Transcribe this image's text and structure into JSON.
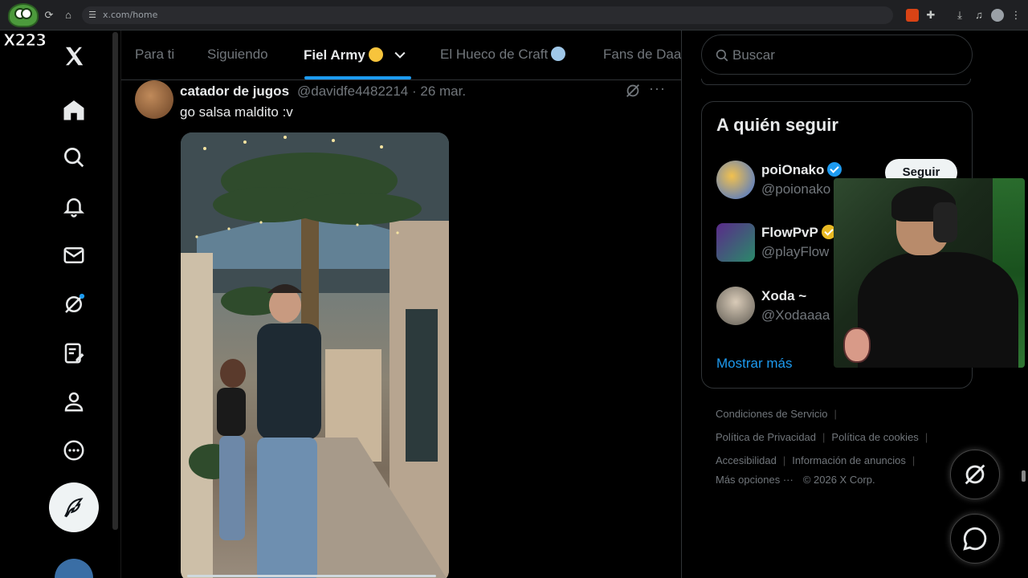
{
  "browser": {
    "url": "x.com/home"
  },
  "overlay": {
    "streamer_tag": "X223"
  },
  "tabs": [
    {
      "label": "Para ti",
      "active": false
    },
    {
      "label": "Siguiendo",
      "active": false
    },
    {
      "label": "Fiel Army",
      "active": true
    },
    {
      "label": "El Hueco de Craft",
      "active": false
    },
    {
      "label": "Fans de Daa",
      "active": false
    }
  ],
  "post": {
    "author_name": "catador de jugos",
    "handle_date": "@davidfe4482214 · 26 mar.",
    "text": "go salsa maldito :v",
    "more": "···"
  },
  "search": {
    "placeholder": "Buscar"
  },
  "who_to_follow": {
    "title": "A quién seguir",
    "follow_label": "Seguir",
    "accounts": [
      {
        "name": "poiOnako",
        "handle": "@poionako",
        "verified_color": "#1d9bf0",
        "avatar_color": "#3b6fd8"
      },
      {
        "name": "FlowPvP",
        "handle": "@playFlow",
        "verified_color": "#e8b923",
        "avatar_color": "#5a2a8a"
      },
      {
        "name": "Xoda ~",
        "handle": "@Xodaaaa",
        "verified_color": "",
        "avatar_color": "#8a8a7a"
      }
    ],
    "show_more": "Mostrar más"
  },
  "footer": {
    "terms": "Condiciones de Servicio",
    "privacy": "Política de Privacidad",
    "cookies": "Política de cookies",
    "accessibility": "Accesibilidad",
    "ads_info": "Información de anuncios",
    "more": "Más opciones ···",
    "copyright": "© 2026 X Corp."
  },
  "colors": {
    "accent": "#1d9bf0",
    "background": "#000000",
    "text_primary": "#e7e9ea",
    "text_secondary": "#71767b"
  }
}
